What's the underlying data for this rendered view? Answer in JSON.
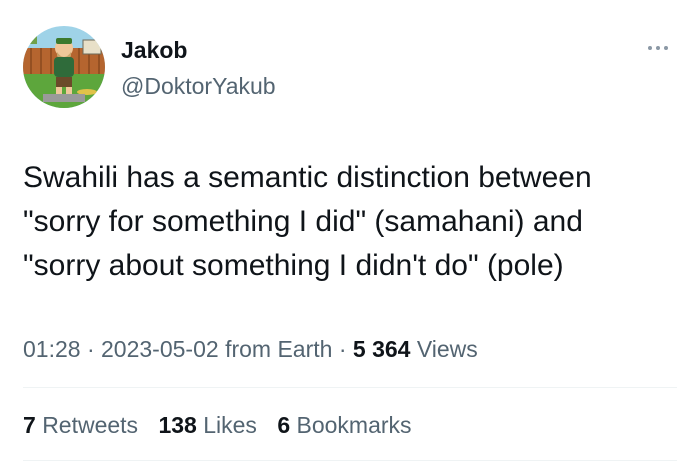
{
  "author": {
    "name": "Jakob",
    "handle": "@DoktorYakub"
  },
  "tweet": {
    "lines": [
      "Swahili has a semantic distinction between",
      "\"sorry for something I did\" (samahani) and",
      "\"sorry about something I didn't do\" (pole)"
    ]
  },
  "meta": {
    "time": "01:28",
    "separator": "·",
    "date": "2023-05-02",
    "source": "from Earth",
    "views_count": "5 364",
    "views_label": "Views"
  },
  "stats": {
    "retweets_count": "7",
    "retweets_label": "Retweets",
    "likes_count": "138",
    "likes_label": "Likes",
    "bookmarks_count": "6",
    "bookmarks_label": "Bookmarks"
  },
  "icons": {
    "more": "more-dots-icon"
  },
  "colors": {
    "text_primary": "#0f1419",
    "text_secondary": "#536471",
    "divider": "#eff3f4"
  }
}
